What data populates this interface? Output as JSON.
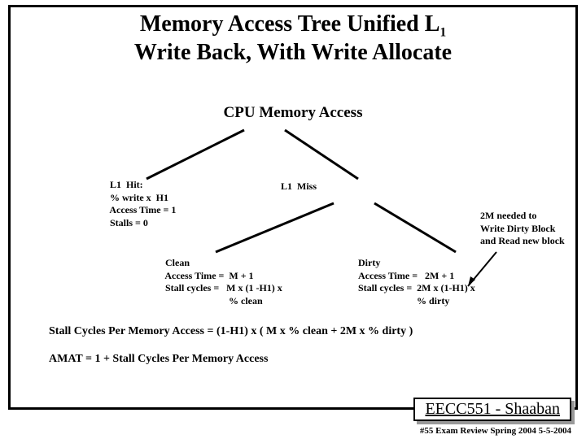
{
  "title_line1_pre": "Memory Access Tree Unified L",
  "title_line1_sub": "1",
  "title_line2": "Write Back,  With Write Allocate",
  "root": "CPU Memory  Access",
  "hit_block": " L1  Hit:\n % write x  H1\n Access Time = 1\n Stalls = 0",
  "miss_label": "L1  Miss",
  "clean_block": " Clean\n Access Time =  M + 1\n Stall cycles =   M x (1 -H1) x\n                           % clean",
  "dirty_block": "Dirty\nAccess Time =   2M + 1\nStall cycles =  2M x (1-H1) x\n                        % dirty",
  "side_note": "2M needed to\nWrite Dirty Block\nand Read new block",
  "formula1_left": "Stall Cycles Per Memory Access = ",
  "formula1_right": "(1-H1)  x  ( M  x   % clean   +  2M  x    % dirty )",
  "formula2": "AMAT =   1 + Stall Cycles Per Memory Access",
  "footer": "EECC551 - Shaaban",
  "pageno": "#55    Exam  Review  Spring  2004  5-5-2004"
}
